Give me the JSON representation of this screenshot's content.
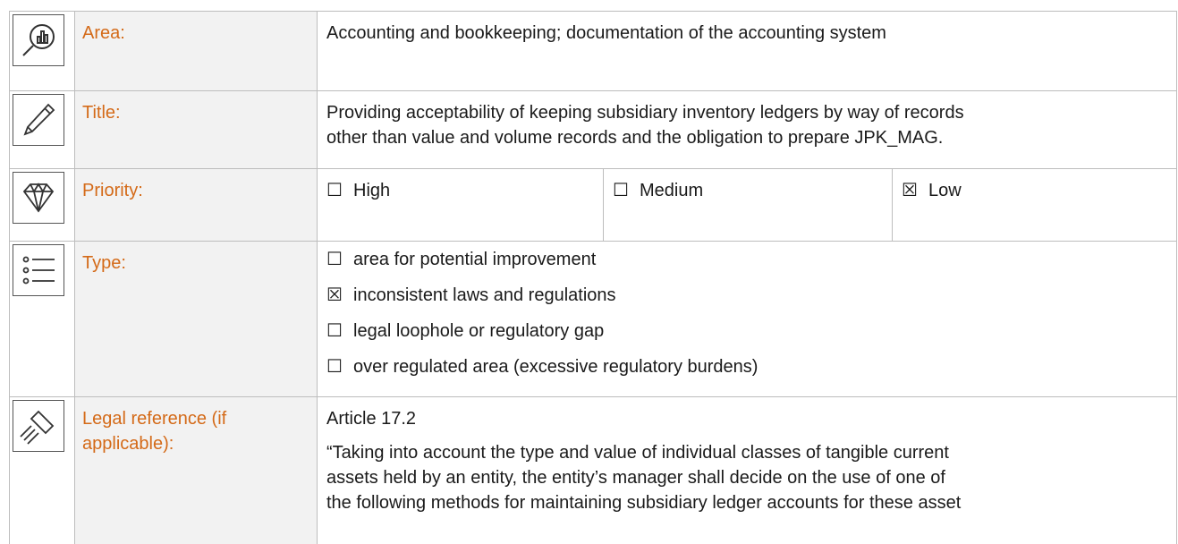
{
  "rows": {
    "area": {
      "icon": "magnifier-chart-icon",
      "label": "Area:",
      "text": "Accounting and bookkeeping; documentation of the accounting system"
    },
    "title": {
      "icon": "pencil-icon",
      "label": "Title:",
      "line1": "Providing acceptability of keeping subsidiary inventory ledgers by way of records",
      "line2": "other than value and volume records and the obligation to prepare JPK_MAG."
    },
    "priority": {
      "icon": "diamond-icon",
      "label": "Priority:",
      "options": [
        {
          "mark": "☐",
          "text": "High",
          "checked": false
        },
        {
          "mark": "☐",
          "text": "Medium",
          "checked": false
        },
        {
          "mark": "☒",
          "text": "Low",
          "checked": true
        }
      ]
    },
    "type": {
      "icon": "list-icon",
      "label": "Type:",
      "options": [
        {
          "mark": "☐",
          "text": "area for potential improvement",
          "checked": false
        },
        {
          "mark": "☒",
          "text": "inconsistent laws and regulations",
          "checked": true
        },
        {
          "mark": "☐",
          "text": "legal loophole or regulatory gap",
          "checked": false
        },
        {
          "mark": "☐",
          "text": "over regulated area (excessive regulatory burdens)",
          "checked": false
        }
      ]
    },
    "legal": {
      "icon": "gavel-icon",
      "label_line1": "Legal reference (if",
      "label_line2": "applicable):",
      "article": "Article 17.2",
      "quote_line1": "“Taking into account the type and value of individual classes of tangible current",
      "quote_line2": "assets held by an entity, the entity’s manager shall decide on the use of one of",
      "quote_line3": "the following methods for maintaining subsidiary ledger accounts for these asset"
    }
  },
  "colors": {
    "label": "#d46a18",
    "border": "#bdbdbd",
    "label_bg": "#f2f2f2",
    "text": "#1a1a1a"
  }
}
